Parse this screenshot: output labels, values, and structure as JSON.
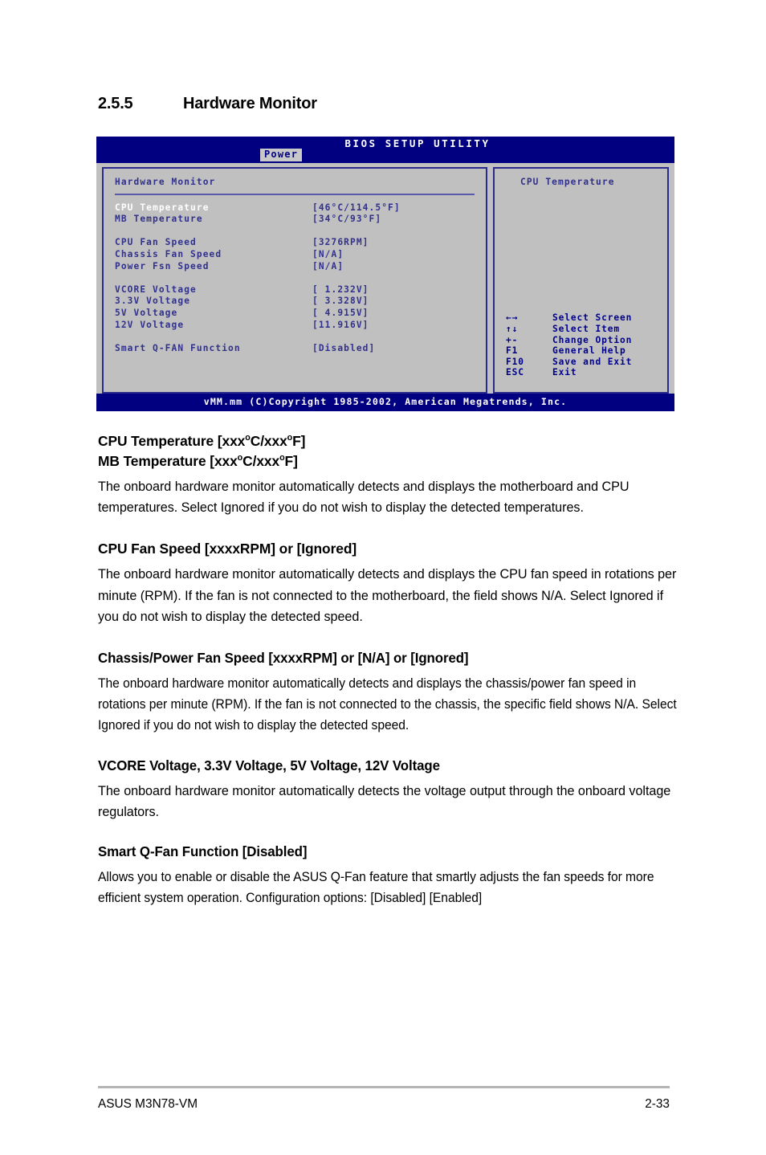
{
  "section": {
    "number": "2.5.5",
    "title": "Hardware Monitor"
  },
  "bios": {
    "title": "BIOS SETUP UTILITY",
    "tab": "Power",
    "pane_heading": "Hardware Monitor",
    "items": [
      {
        "label": "CPU Temperature",
        "value": "[46°C/114.5°F]",
        "selected": true
      },
      {
        "label": "MB Temperature",
        "value": "[34°C/93°F]",
        "selected": false
      },
      {
        "label": "CPU Fan Speed",
        "value": "[3276RPM]",
        "selected": false
      },
      {
        "label": "Chassis Fan Speed",
        "value": "[N/A]",
        "selected": false
      },
      {
        "label": "Power Fsn Speed",
        "value": "[N/A]",
        "selected": false
      },
      {
        "label": "VCORE Voltage",
        "value": "[ 1.232V]",
        "selected": false
      },
      {
        "label": "3.3V Voltage",
        "value": "[ 3.328V]",
        "selected": false
      },
      {
        "label": "5V Voltage",
        "value": "[ 4.915V]",
        "selected": false
      },
      {
        "label": "12V Voltage",
        "value": "[11.916V]",
        "selected": false
      },
      {
        "label": "Smart Q-FAN Function",
        "value": "[Disabled]",
        "selected": false
      }
    ],
    "help_title": "CPU Temperature",
    "legend": [
      {
        "key": "←→",
        "action": "Select Screen"
      },
      {
        "key": "↑↓",
        "action": "Select Item"
      },
      {
        "key": "+-",
        "action": "Change Option"
      },
      {
        "key": "F1",
        "action": "General Help"
      },
      {
        "key": "F10",
        "action": "Save and Exit"
      },
      {
        "key": "ESC",
        "action": "Exit"
      }
    ],
    "footer": "vMM.mm (C)Copyright 1985-2002, American Megatrends, Inc.",
    "colors": {
      "titlebar": "#000080",
      "panel": "#c0c0c0",
      "border": "#2a2a8c",
      "text": "#31318c",
      "selected_text": "#ffffff",
      "rule": "#5a5aaa"
    }
  },
  "sections": [
    {
      "heading_line1": "CPU Temperature [xxxoC/xxxoF]",
      "heading_line2": "MB Temperature [xxxoC/xxxoF]",
      "body": "The onboard hardware monitor automatically detects and displays the motherboard and CPU temperatures. Select Ignored if you do not wish to display the detected temperatures."
    },
    {
      "heading": "CPU Fan Speed [xxxxRPM] or [Ignored]",
      "body": "The onboard hardware monitor automatically detects and displays the CPU fan speed in rotations per minute (RPM). If the fan is not connected to the motherboard, the field shows N/A. Select Ignored if you do not wish to display the detected speed."
    },
    {
      "heading": "Chassis/Power Fan Speed [xxxxRPM] or [N/A] or [Ignored]",
      "body": "The onboard hardware monitor automatically detects and displays the chassis/power fan speed in rotations per minute (RPM). If the fan is not connected to the chassis, the specific field shows N/A. Select Ignored if you do not wish to display the detected speed."
    },
    {
      "heading": "VCORE Voltage, 3.3V Voltage, 5V Voltage, 12V Voltage",
      "body": "The onboard hardware monitor automatically detects the voltage output through the onboard voltage regulators."
    },
    {
      "heading": "Smart Q-Fan Function [Disabled]",
      "body": "Allows you to enable or disable the ASUS Q-Fan feature that smartly adjusts the fan speeds for more efficient system operation. Configuration options: [Disabled] [Enabled]"
    }
  ],
  "page_footer": {
    "model": "ASUS M3N78-VM",
    "page_number": "2-33"
  }
}
